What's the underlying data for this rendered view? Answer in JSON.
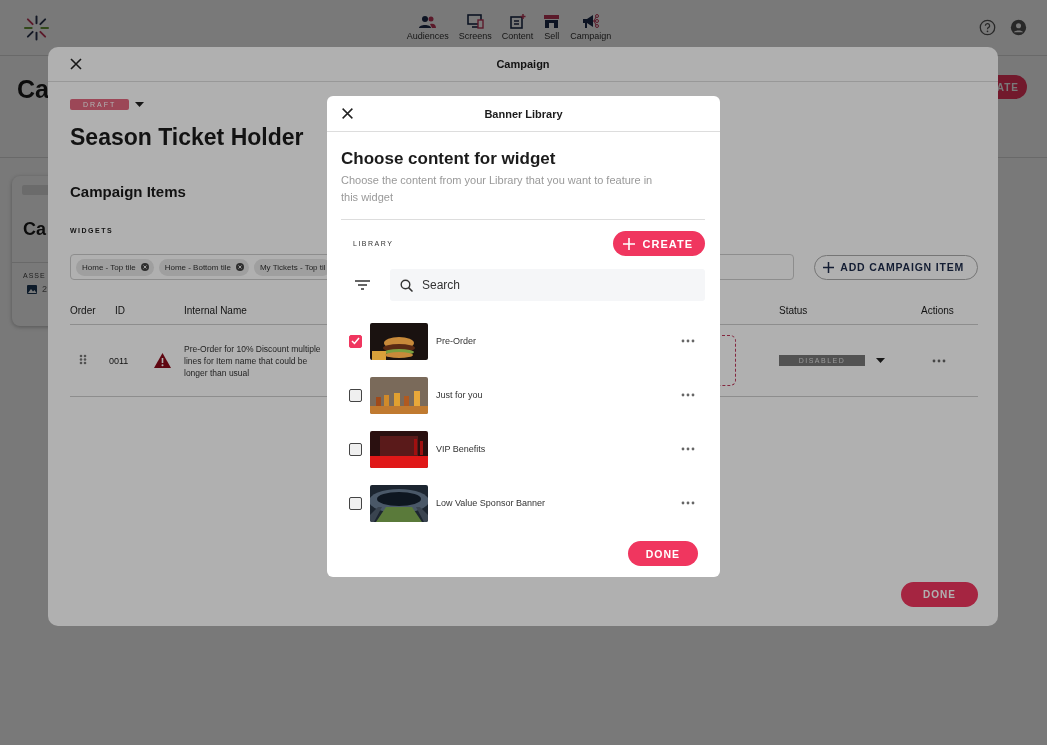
{
  "app_header": {
    "nav": [
      {
        "label": "Audiences"
      },
      {
        "label": "Screens"
      },
      {
        "label": "Content"
      },
      {
        "label": "Sell"
      },
      {
        "label": "Campaign"
      }
    ]
  },
  "page": {
    "title": "Ca",
    "primary_button": "ATE",
    "card": {
      "title": "Ca",
      "section_label": "ASSE",
      "asset_count": "2"
    }
  },
  "campaign_modal": {
    "title": "Campaign",
    "status": "DRAFT",
    "name": "Season Ticket Holder",
    "section_title": "Campaign Items",
    "widgets_label": "WIDGETS",
    "widgets": [
      {
        "label": "Home - Top tile",
        "removable": true
      },
      {
        "label": "Home - Bottom tile",
        "removable": true
      },
      {
        "label": "My Tickets - Top til",
        "removable": false
      }
    ],
    "add_button": "ADD CAMPAIGN ITEM",
    "table": {
      "columns": [
        "Order",
        "ID",
        "Internal Name",
        "Status",
        "Actions"
      ],
      "rows": [
        {
          "id": "0011",
          "warning": true,
          "internal_name": "Pre-Order for 10% Discount multiple lines for Item name that could be longer than usual",
          "status": "DISABLED"
        }
      ]
    },
    "done_button": "DONE"
  },
  "banner_library": {
    "title": "Banner Library",
    "heading": "Choose content for widget",
    "description": "Choose the content from your Library that you want to feature in this widget",
    "library_label": "LIBRARY",
    "create_button": "CREATE",
    "search": {
      "placeholder": "Search"
    },
    "items": [
      {
        "name": "Pre-Order",
        "checked": true,
        "kind": "picture"
      },
      {
        "name": "Just for you",
        "checked": false,
        "kind": "picture"
      },
      {
        "name": "VIP Benefits",
        "checked": false,
        "kind": "picture"
      },
      {
        "name": "Low Value Sponsor Banner",
        "checked": false,
        "kind": "picture"
      }
    ],
    "done_button": "DONE"
  }
}
